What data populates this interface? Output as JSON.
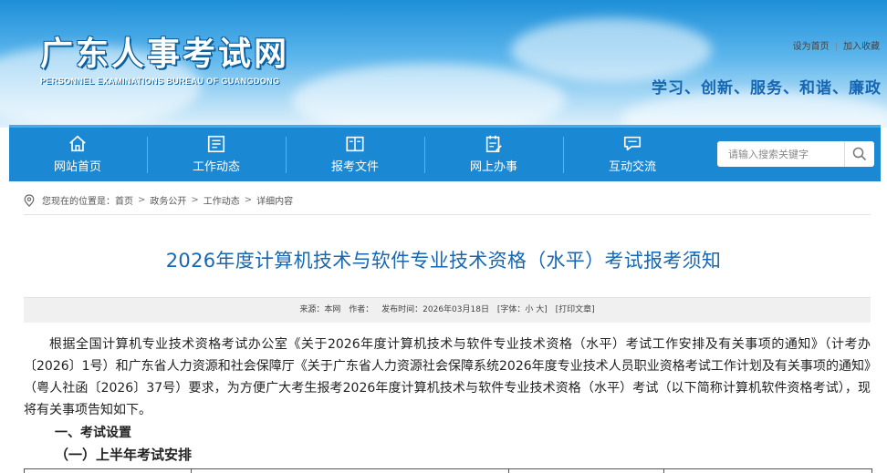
{
  "header": {
    "site_title": "广东人事考试网",
    "site_subtitle": "PERSONNEL EXAMINATIONS BUREAU OF GUANGDONG",
    "set_home": "设为首页",
    "separator": "|",
    "add_favorite": "加入收藏",
    "slogan": "学习、创新、服务、和谐、廉政"
  },
  "nav": {
    "items": [
      {
        "label": "网站首页",
        "icon": "home-icon"
      },
      {
        "label": "工作动态",
        "icon": "news-icon"
      },
      {
        "label": "报考文件",
        "icon": "book-icon"
      },
      {
        "label": "网上办事",
        "icon": "clipboard-icon"
      },
      {
        "label": "互动交流",
        "icon": "chat-icon"
      }
    ],
    "search_placeholder": "请输入搜索关键字",
    "search_icon": "search-icon"
  },
  "breadcrumb": {
    "prefix": "您现在的位置是：",
    "items": [
      "首页",
      "政务公开",
      "工作动态",
      "详细内容"
    ],
    "arrow": ">"
  },
  "article": {
    "title": "2026年度计算机技术与软件专业技术资格（水平）考试报考须知",
    "meta": {
      "source": "来源：本网",
      "author": "作者：",
      "published": "发布时间：2026年03月18日",
      "font_size": "[字体：小 大]",
      "print": "[打印文章]"
    },
    "paragraph": "根据全国计算机专业技术资格考试办公室《关于2026年度计算机技术与软件专业技术资格（水平）考试工作安排及有关事项的通知》（计考办〔2026〕1号）和广东省人力资源和社会保障厅《关于广东省人力资源社会保障系统2026年度专业技术人员职业资格考试工作计划及有关事项的通知》（粤人社函〔2026〕37号）要求，为方便广大考生报考2026年度计算机技术与软件专业技术资格（水平）考试（以下简称计算机软件资格考试），现将有关事项告知如下。",
    "section_1": "一、考试设置",
    "subsection_1": "（一）上半年考试安排"
  },
  "colors": {
    "nav_bg": "#1a88d3",
    "title_blue": "#1767b3",
    "meta_bg": "#f0f0f0"
  }
}
